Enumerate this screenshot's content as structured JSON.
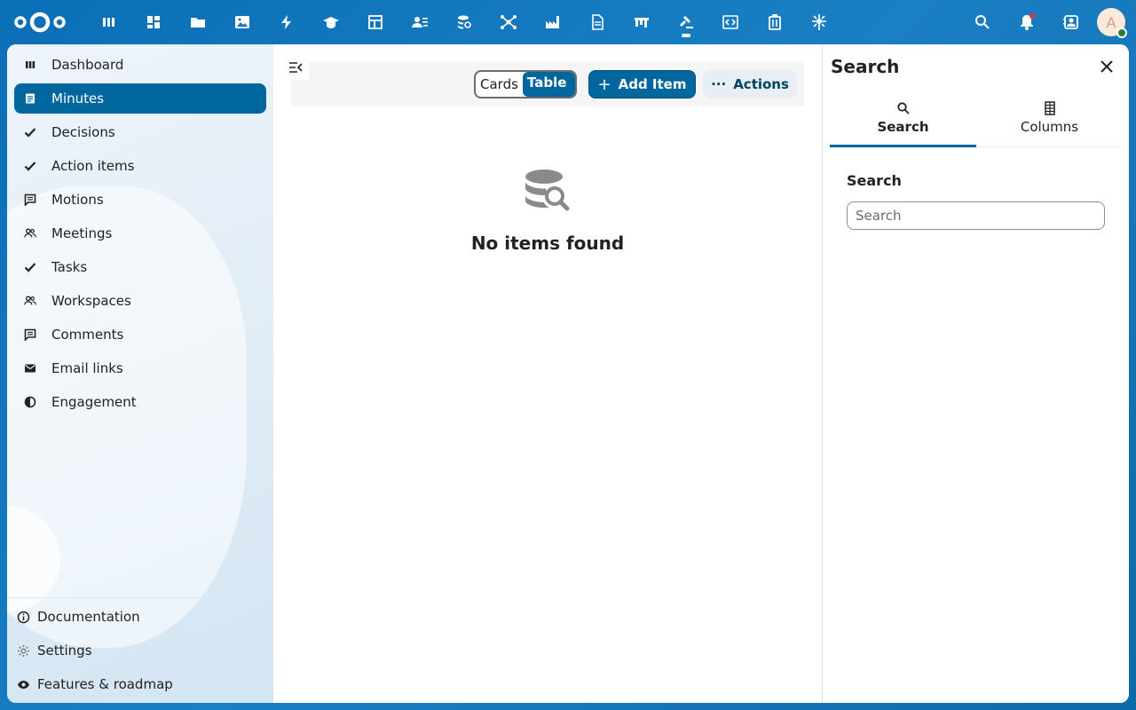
{
  "header": {
    "logo_icon": "nextcloud-logo-icon",
    "apps": [
      {
        "name": "dashboard-app-icon"
      },
      {
        "name": "grid-app-icon"
      },
      {
        "name": "files-app-icon"
      },
      {
        "name": "photos-app-icon"
      },
      {
        "name": "activity-app-icon"
      },
      {
        "name": "learn-app-icon"
      },
      {
        "name": "tables-app-icon"
      },
      {
        "name": "contacts-app-icon"
      },
      {
        "name": "database-app-icon"
      },
      {
        "name": "network-app-icon"
      },
      {
        "name": "industry-app-icon"
      },
      {
        "name": "document-app-icon"
      },
      {
        "name": "board-app-icon"
      },
      {
        "name": "gavel-app-icon",
        "active": true
      },
      {
        "name": "code-app-icon"
      },
      {
        "name": "archive-app-icon"
      },
      {
        "name": "flower-app-icon"
      }
    ],
    "avatar_initial": "A"
  },
  "sidebar": {
    "items": [
      {
        "label": "Dashboard",
        "icon": "dashboard-icon"
      },
      {
        "label": "Minutes",
        "icon": "document-icon",
        "active": true
      },
      {
        "label": "Decisions",
        "icon": "check-icon"
      },
      {
        "label": "Action items",
        "icon": "check-icon"
      },
      {
        "label": "Motions",
        "icon": "comment-icon"
      },
      {
        "label": "Meetings",
        "icon": "people-icon"
      },
      {
        "label": "Tasks",
        "icon": "check-icon"
      },
      {
        "label": "Workspaces",
        "icon": "people-icon"
      },
      {
        "label": "Comments",
        "icon": "comment-icon"
      },
      {
        "label": "Email links",
        "icon": "email-icon"
      },
      {
        "label": "Engagement",
        "icon": "half-circle-icon"
      }
    ],
    "footer": [
      {
        "label": "Documentation",
        "icon": "info-icon"
      },
      {
        "label": "Settings",
        "icon": "gear-icon"
      },
      {
        "label": "Features & roadmap",
        "icon": "eye-icon"
      }
    ]
  },
  "toolbar": {
    "view_cards": "Cards",
    "view_table": "Table",
    "add_label": "Add Item",
    "actions_label": "Actions"
  },
  "empty_state": {
    "title": "No items found"
  },
  "panel": {
    "title": "Search",
    "tabs": [
      {
        "label": "Search",
        "active": true
      },
      {
        "label": "Columns"
      }
    ],
    "search_label": "Search",
    "search_placeholder": "Search",
    "search_value": ""
  },
  "colors": {
    "primary": "#00679e",
    "header_bg": "#0a6fb6"
  }
}
